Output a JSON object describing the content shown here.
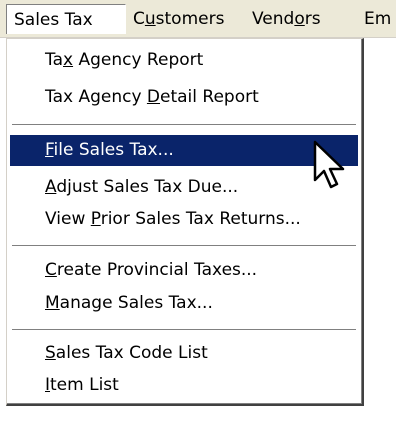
{
  "menubar": {
    "sales_tax": "Sales Tax",
    "customers_pre": "C",
    "customers_u": "u",
    "customers_post": "stomers",
    "vendors_pre": "Vend",
    "vendors_u": "o",
    "vendors_post": "rs",
    "em": "Em"
  },
  "menu": {
    "tax_agency_report": {
      "pre": "Ta",
      "u": "x",
      "post": " Agency Report"
    },
    "tax_agency_detail": {
      "pre": "Tax Agency ",
      "u": "D",
      "post": "etail Report"
    },
    "file_sales_tax": {
      "pre": "",
      "u": "F",
      "post": "ile Sales Tax..."
    },
    "adjust_sales_tax": {
      "pre": "",
      "u": "A",
      "post": "djust Sales Tax Due..."
    },
    "view_prior": {
      "pre": "View ",
      "u": "P",
      "post": "rior Sales Tax Returns..."
    },
    "create_provincial": {
      "pre": "",
      "u": "C",
      "post": "reate Provincial Taxes..."
    },
    "manage_sales_tax": {
      "pre": "",
      "u": "M",
      "post": "anage Sales Tax..."
    },
    "sales_tax_code_list": {
      "pre": "",
      "u": "S",
      "post": "ales Tax Code List"
    },
    "item_list": {
      "pre": "",
      "u": "I",
      "post": "tem List"
    }
  },
  "colors": {
    "highlight": "#0a246a",
    "menubar_bg": "#ece9d8"
  },
  "icons": {
    "cursor": "arrow-pointer-icon"
  }
}
